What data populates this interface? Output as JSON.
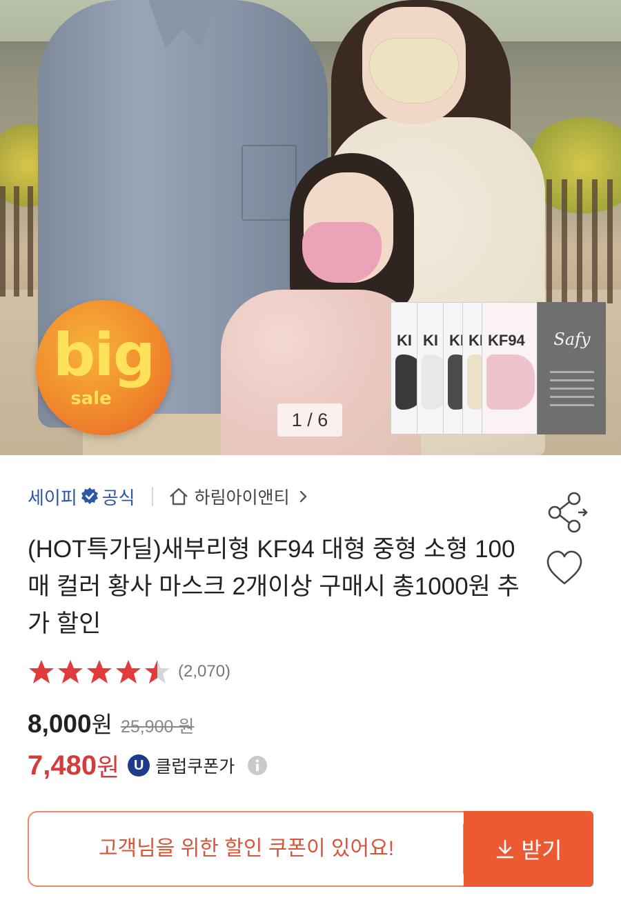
{
  "hero": {
    "badge_big": "big",
    "badge_sale": "sale",
    "pager": "1 / 6",
    "package_labels": [
      "KI",
      "KI",
      "KI",
      "KI",
      "KF94"
    ],
    "package_brand": "Safy",
    "colors": {
      "badge": "#f08a2c",
      "badge_text": "#ffe25a"
    }
  },
  "seller": {
    "name": "세이피",
    "official": "공식",
    "brand": "하림아이앤티",
    "colors": {
      "seller": "#2b55a8"
    }
  },
  "product": {
    "title": "(HOT특가딜)새부리형 KF94 대형 중형 소형 100매 컬러 황사 마스크 2개이상 구매시 총1000원 추가 할인"
  },
  "rating": {
    "stars": 4.5,
    "count": "(2,070)",
    "star_color": "#e23b3b"
  },
  "price": {
    "amount": "8,000",
    "unit": "원",
    "original": "25,900 원"
  },
  "club_coupon": {
    "amount": "7,480",
    "unit": "원",
    "badge": "U",
    "label": "클럽쿠폰가",
    "color": "#d43c3c"
  },
  "coupon_banner": {
    "text": "고객님을 위한 할인 쿠폰이 있어요!",
    "button_label": "받기",
    "colors": {
      "border": "#e98a6a",
      "button": "#ec5a34"
    }
  },
  "icons": [
    "verified-icon",
    "home-icon",
    "chevron-right-icon",
    "share-icon",
    "heart-icon",
    "star-icon",
    "info-icon",
    "download-icon"
  ]
}
